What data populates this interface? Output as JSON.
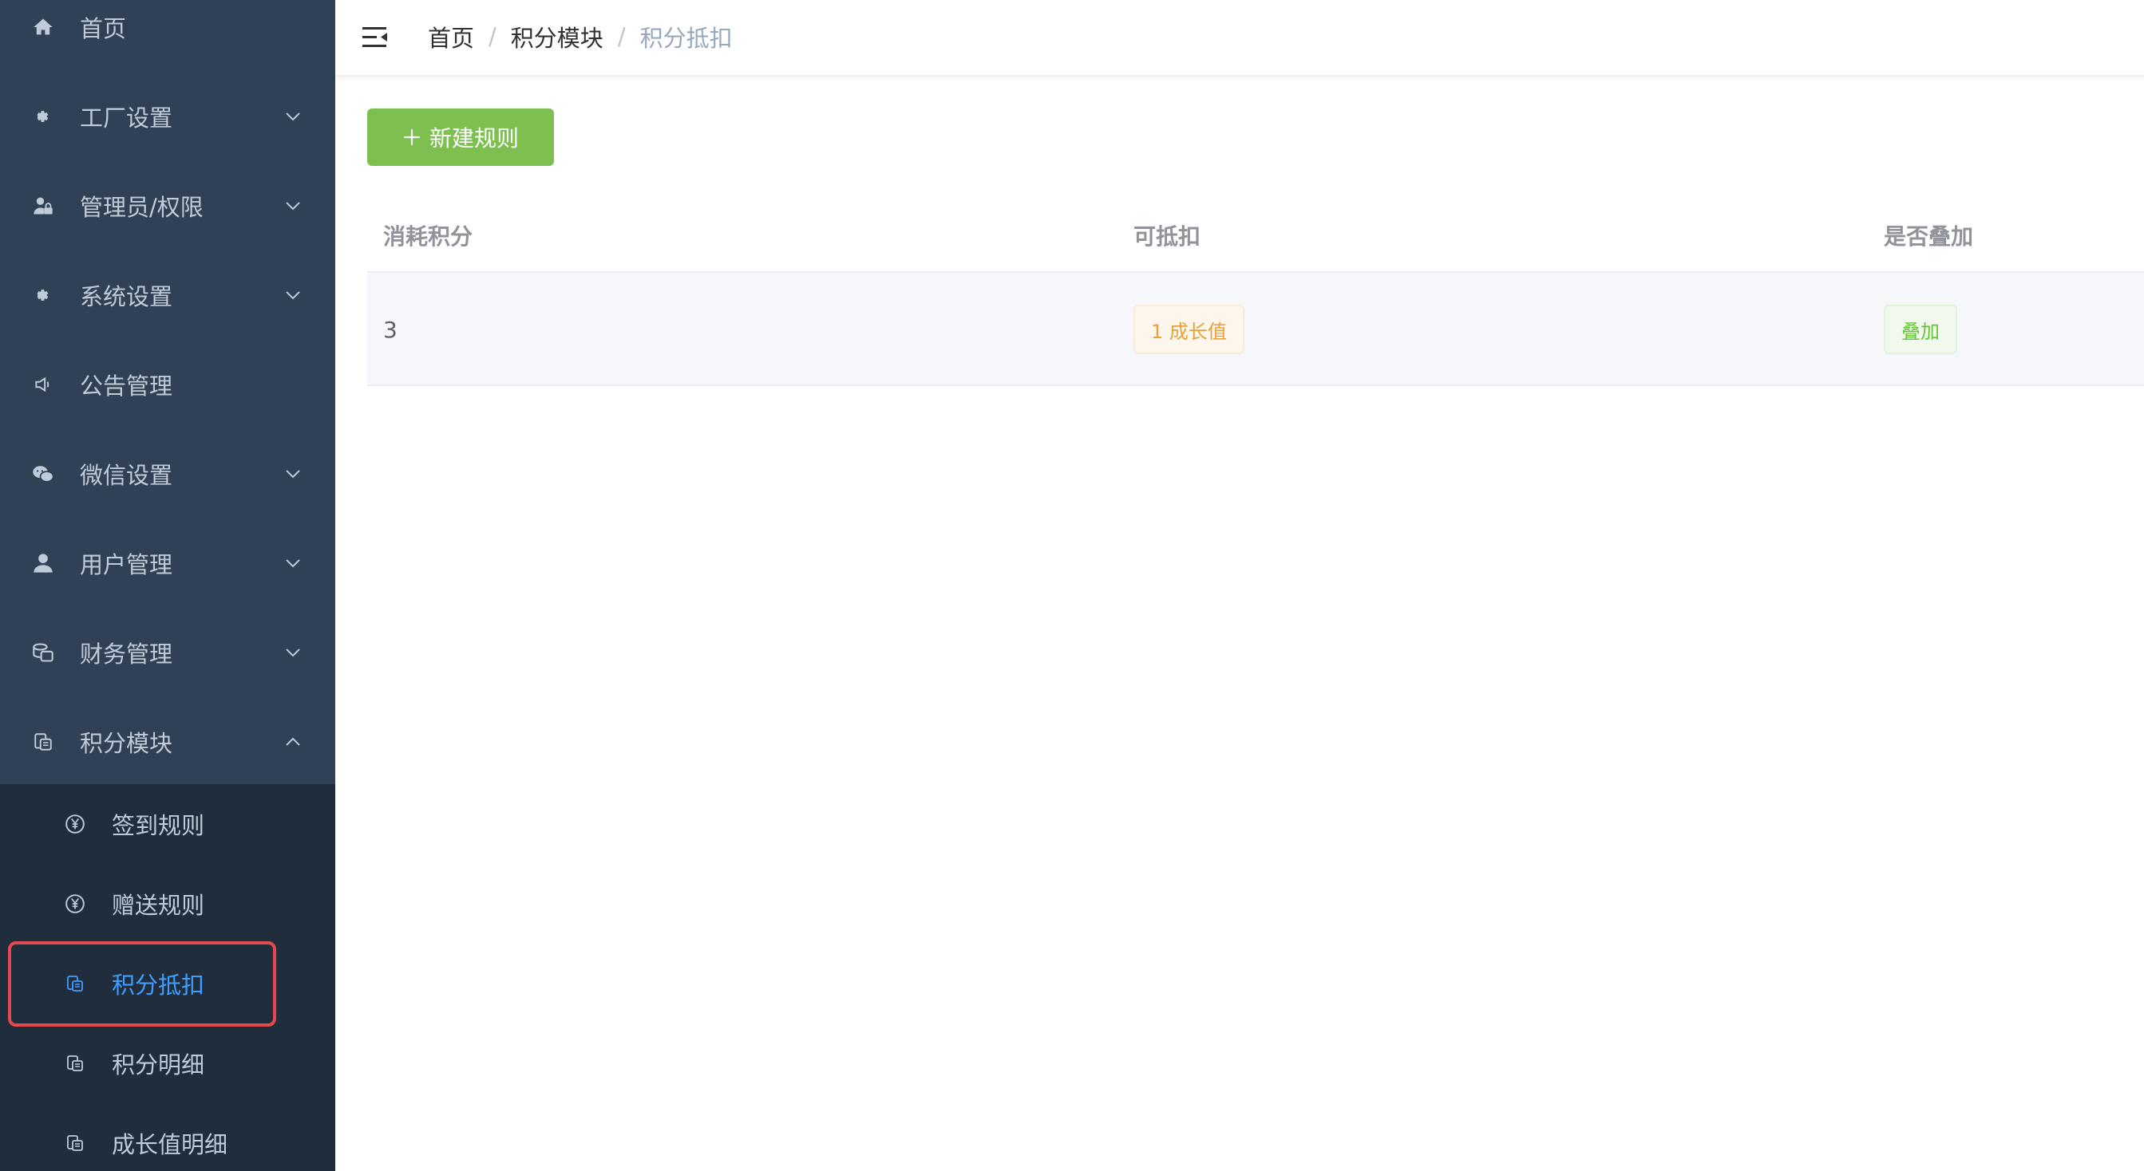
{
  "sidebar": {
    "items": [
      {
        "label": "首页",
        "icon": "home-icon"
      },
      {
        "label": "工厂设置",
        "icon": "gear-icon"
      },
      {
        "label": "管理员/权限",
        "icon": "admin-lock-icon"
      },
      {
        "label": "系统设置",
        "icon": "gear-icon"
      },
      {
        "label": "公告管理",
        "icon": "speaker-icon"
      },
      {
        "label": "微信设置",
        "icon": "wechat-icon"
      },
      {
        "label": "用户管理",
        "icon": "user-icon"
      },
      {
        "label": "财务管理",
        "icon": "coins-icon"
      },
      {
        "label": "积分模块",
        "icon": "points-icon"
      }
    ],
    "subitems": [
      {
        "label": "签到规则",
        "icon": "yen-circle-icon"
      },
      {
        "label": "赠送规则",
        "icon": "yen-circle-icon"
      },
      {
        "label": "积分抵扣",
        "icon": "points-icon"
      },
      {
        "label": "积分明细",
        "icon": "points-icon"
      },
      {
        "label": "成长值明细",
        "icon": "points-icon"
      }
    ],
    "active_submenu": "积分抵扣"
  },
  "header": {
    "breadcrumb": [
      "首页",
      "积分模块",
      "积分抵扣"
    ],
    "separator": "/"
  },
  "toolbar": {
    "new_rule_label": "新建规则"
  },
  "table": {
    "columns": [
      "消耗积分",
      "可抵扣",
      "是否叠加"
    ],
    "rows": [
      {
        "points": "3",
        "deductible": "1 成长值",
        "stackable": "叠加"
      }
    ]
  },
  "colors": {
    "sidebar_bg": "#304156",
    "submenu_bg": "#1f2d3d",
    "active": "#409eff",
    "primary_button": "#7ec050",
    "highlight_border": "#e5484d"
  }
}
